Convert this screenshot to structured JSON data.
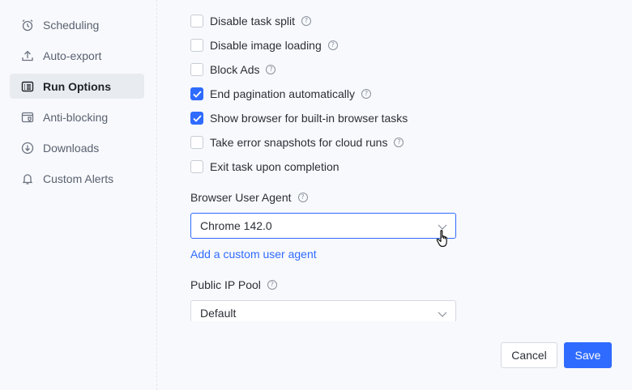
{
  "sidebar": {
    "items": [
      {
        "label": "Scheduling",
        "icon": "alarm-clock-icon"
      },
      {
        "label": "Auto-export",
        "icon": "upload-icon"
      },
      {
        "label": "Run Options",
        "icon": "list-icon",
        "active": true
      },
      {
        "label": "Anti-blocking",
        "icon": "browser-shield-icon"
      },
      {
        "label": "Downloads",
        "icon": "download-circle-icon"
      },
      {
        "label": "Custom Alerts",
        "icon": "bell-icon"
      }
    ]
  },
  "options": [
    {
      "label": "Disable task split",
      "checked": false,
      "help": true
    },
    {
      "label": "Disable image loading",
      "checked": false,
      "help": true
    },
    {
      "label": "Block Ads",
      "checked": false,
      "help": true
    },
    {
      "label": "End pagination automatically",
      "checked": true,
      "help": true
    },
    {
      "label": "Show browser for built-in browser tasks",
      "checked": true,
      "help": false
    },
    {
      "label": "Take error snapshots for cloud runs",
      "checked": false,
      "help": true
    },
    {
      "label": "Exit task upon completion",
      "checked": false,
      "help": false
    }
  ],
  "user_agent": {
    "label": "Browser User Agent",
    "value": "Chrome 142.0",
    "add_link": "Add a custom user agent"
  },
  "ip_pool": {
    "label": "Public IP Pool",
    "value": "Default"
  },
  "footer": {
    "cancel_label": "Cancel",
    "save_label": "Save"
  },
  "colors": {
    "accent": "#2f6bff",
    "active_bg": "#e8ebf0"
  }
}
